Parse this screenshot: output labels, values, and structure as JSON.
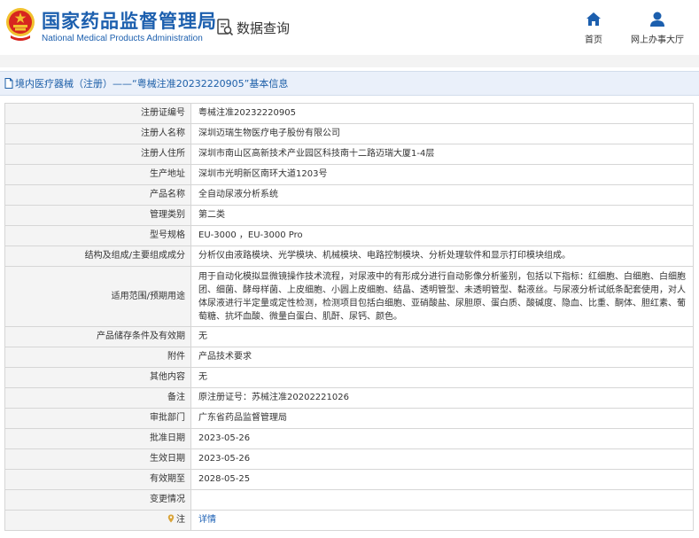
{
  "header": {
    "title_cn": "国家药品监督管理局",
    "title_en": "National Medical Products Administration",
    "logo_icon": "national-emblem-icon",
    "data_query_label": "数据查询",
    "nav": {
      "home_label": "首页",
      "hall_label": "网上办事大厅"
    },
    "brand_color": "#1c5fae",
    "emblem_red": "#d7261f",
    "emblem_gold": "#f2c12e"
  },
  "breadcrumb": {
    "text": "境内医疗器械（注册）——“粤械注准20232220905”基本信息"
  },
  "record": {
    "rows": [
      {
        "key": "注册证编号",
        "value": "粤械注准20232220905"
      },
      {
        "key": "注册人名称",
        "value": "深圳迈瑞生物医疗电子股份有限公司"
      },
      {
        "key": "注册人住所",
        "value": "深圳市南山区高新技术产业园区科技南十二路迈瑞大厦1-4层"
      },
      {
        "key": "生产地址",
        "value": "深圳市光明新区南环大道1203号"
      },
      {
        "key": "产品名称",
        "value": "全自动尿液分析系统"
      },
      {
        "key": "管理类别",
        "value": "第二类"
      },
      {
        "key": "型号规格",
        "value": "EU-3000 ，EU-3000 Pro"
      },
      {
        "key": "结构及组成/主要组成成分",
        "value": "分析仪由液路模块、光学模块、机械模块、电路控制模块、分析处理软件和显示打印模块组成。"
      },
      {
        "key": "适用范围/预期用途",
        "value": "用于自动化模拟显微镜操作技术流程，对尿液中的有形成分进行自动影像分析鉴别，包括以下指标：红细胞、白细胞、白细胞团、细菌、酵母样菌、上皮细胞、小圆上皮细胞、结晶、透明管型、未透明管型、黏液丝。与尿液分析试纸条配套使用，对人体尿液进行半定量或定性检测，检测项目包括白细胞、亚硝酸盐、尿胆原、蛋白质、酸碱度、隐血、比重、酮体、胆红素、葡萄糖、抗坏血酸、微量白蛋白、肌酐、尿钙、颜色。"
      },
      {
        "key": "产品储存条件及有效期",
        "value": "无"
      },
      {
        "key": "附件",
        "value": "产品技术要求"
      },
      {
        "key": "其他内容",
        "value": "无"
      },
      {
        "key": "备注",
        "value": "原注册证号：苏械注准20202221026"
      },
      {
        "key": "审批部门",
        "value": "广东省药品监督管理局"
      },
      {
        "key": "批准日期",
        "value": "2023-05-26"
      },
      {
        "key": "生效日期",
        "value": "2023-05-26"
      },
      {
        "key": "有效期至",
        "value": "2028-05-25"
      },
      {
        "key": "变更情况",
        "value": ""
      },
      {
        "key": "注",
        "value": "详情"
      }
    ]
  }
}
